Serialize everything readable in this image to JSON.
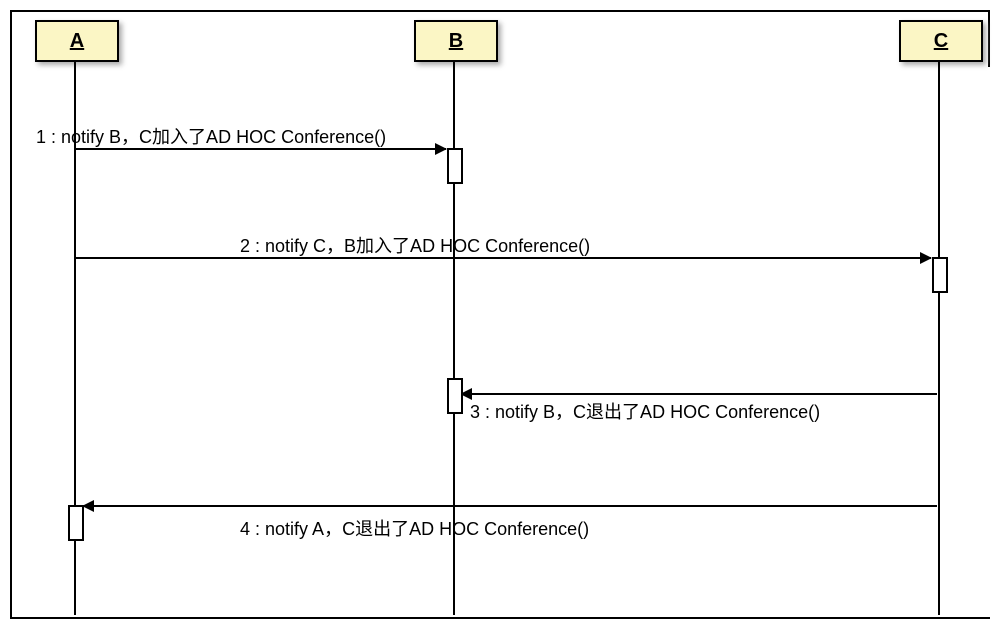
{
  "participants": {
    "a": {
      "label": "A"
    },
    "b": {
      "label": "B"
    },
    "c": {
      "label": "C"
    }
  },
  "messages": {
    "m1": {
      "num": "1",
      "text": "notify B，C加入了AD HOC Conference()"
    },
    "m2": {
      "num": "2",
      "text": "notify C，B加入了AD HOC Conference()"
    },
    "m3": {
      "num": "3",
      "text": "notify B，C退出了AD HOC Conference()"
    },
    "m4": {
      "num": "4",
      "text": "notify A，C退出了AD HOC Conference()"
    }
  },
  "chart_data": {
    "type": "sequence-diagram",
    "participants": [
      "A",
      "B",
      "C"
    ],
    "messages": [
      {
        "seq": 1,
        "from": "A",
        "to": "B",
        "label": "notify B，C加入了AD HOC Conference()"
      },
      {
        "seq": 2,
        "from": "A",
        "to": "C",
        "label": "notify C，B加入了AD HOC Conference()"
      },
      {
        "seq": 3,
        "from": "C",
        "to": "B",
        "label": "notify B，C退出了AD HOC Conference()"
      },
      {
        "seq": 4,
        "from": "C",
        "to": "A",
        "label": "notify A，C退出了AD HOC Conference()"
      }
    ]
  }
}
